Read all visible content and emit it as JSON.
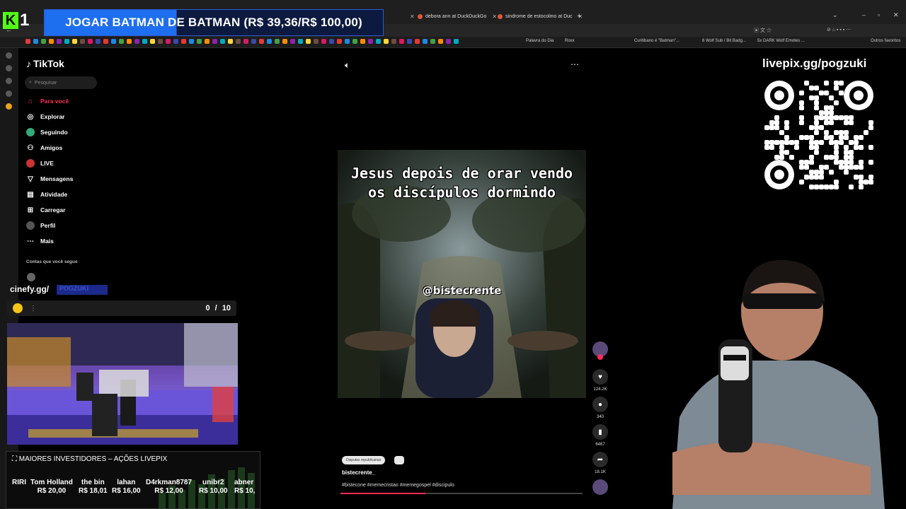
{
  "browser": {
    "tabs": [
      {
        "title": "debora ann at DuckDuckGo"
      },
      {
        "title": "sindrome de estocolmo at Duc"
      }
    ],
    "bookmarks": [
      "Palavra do Dia",
      "Roxx",
      "Curitibano é \"Batman\"...",
      "6 Wolf Sub / Bit Badg...",
      "5x DARK Wolf Emotes ...",
      "Outros favoritos"
    ]
  },
  "overlay": {
    "banner_text": "JOGAR BATMAN DE BATMAN (R$ 39,36/R$ 100,00)",
    "kick_logo_letter": "K",
    "kick_logo_digit": "1",
    "cinefy": "cinefy.gg/",
    "cinefy_name": "POGZUKI",
    "goal_current": "0",
    "goal_sep": "/",
    "goal_total": "10",
    "investors_title": "MAIORES INVESTIDORES – AÇÕES LIVEPIX",
    "investors": [
      {
        "name": "RIRI",
        "amount": ""
      },
      {
        "name": "Tom Holland",
        "amount": "R$ 20,00"
      },
      {
        "name": "the bin",
        "amount": "R$ 18,01"
      },
      {
        "name": "lahan",
        "amount": "R$ 16,00"
      },
      {
        "name": "D4rkman8787",
        "amount": "R$ 12,00"
      },
      {
        "name": "unibr2",
        "amount": "R$ 10,00"
      },
      {
        "name": "abner",
        "amount": "R$ 10,"
      }
    ],
    "livepix_url": "livepix.gg/pogzuki"
  },
  "tiktok": {
    "logo": "TikTok",
    "search_placeholder": "Pesquisar",
    "nav": [
      {
        "label": "Para você",
        "icon": "home-icon"
      },
      {
        "label": "Explorar",
        "icon": "compass-icon"
      },
      {
        "label": "Seguindo",
        "icon": "following-icon"
      },
      {
        "label": "Amigos",
        "icon": "friends-icon"
      },
      {
        "label": "LIVE",
        "icon": "live-icon"
      },
      {
        "label": "Mensagens",
        "icon": "messages-icon"
      },
      {
        "label": "Atividade",
        "icon": "activity-icon"
      },
      {
        "label": "Carregar",
        "icon": "upload-icon"
      },
      {
        "label": "Perfil",
        "icon": "profile-icon"
      },
      {
        "label": "Mais",
        "icon": "more-icon"
      }
    ],
    "follows_header": "Contas que você segue",
    "video": {
      "caption_line1": "Jesus depois de orar vendo",
      "caption_line2": "os discípulos dormindo",
      "watermark": "@bistecrente",
      "likes": "124.2K",
      "comments": "340",
      "saves": "6467",
      "shares": "18.1K",
      "sound_label": "Disputas republicanas",
      "username": "bistecrente_",
      "hashtags": "#bistecone #memecristao #memegospel #discipulo",
      "progress": 0.35
    }
  },
  "colors": {
    "tiktok_red": "#fe2c55",
    "kick_green": "#53fc18",
    "banner_blue": "#1e6ef0"
  }
}
